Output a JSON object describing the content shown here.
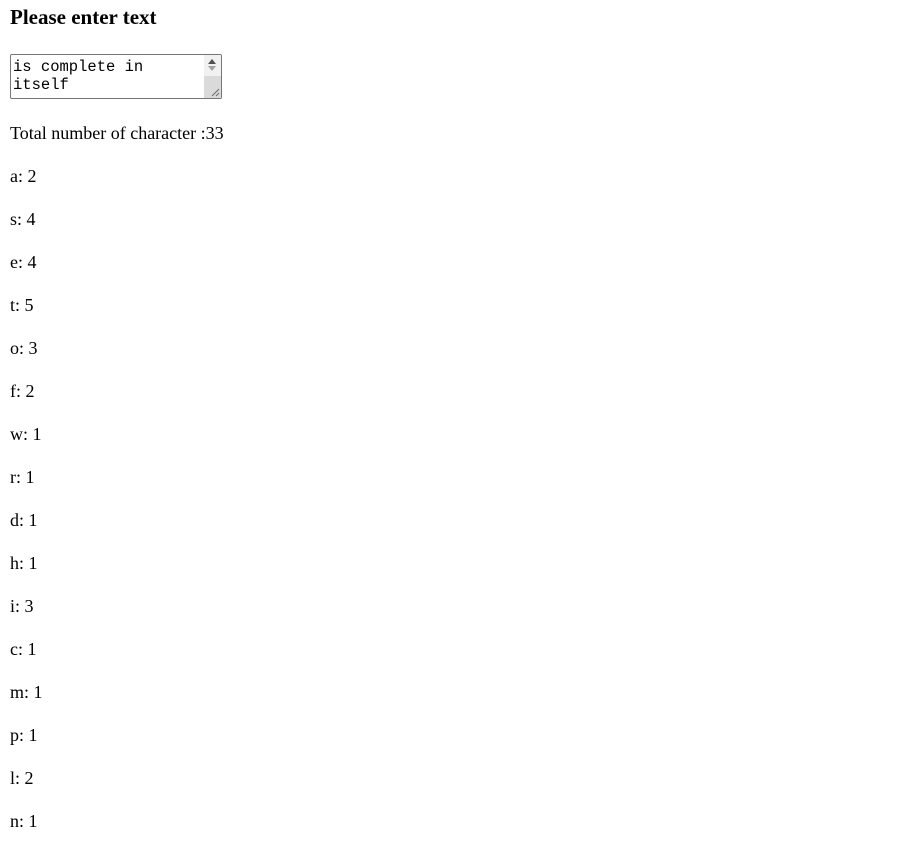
{
  "heading": "Please enter text",
  "textarea": {
    "value": "is complete in\nitself"
  },
  "total": {
    "label": "Total number of character :",
    "value": "33",
    "text": "Total number of character :33"
  },
  "counts": [
    {
      "char": "a",
      "count": 2,
      "text": "a: 2"
    },
    {
      "char": "s",
      "count": 4,
      "text": "s: 4"
    },
    {
      "char": "e",
      "count": 4,
      "text": "e: 4"
    },
    {
      "char": "t",
      "count": 5,
      "text": "t: 5"
    },
    {
      "char": "o",
      "count": 3,
      "text": "o: 3"
    },
    {
      "char": "f",
      "count": 2,
      "text": "f: 2"
    },
    {
      "char": "w",
      "count": 1,
      "text": "w: 1"
    },
    {
      "char": "r",
      "count": 1,
      "text": "r: 1"
    },
    {
      "char": "d",
      "count": 1,
      "text": "d: 1"
    },
    {
      "char": "h",
      "count": 1,
      "text": "h: 1"
    },
    {
      "char": "i",
      "count": 3,
      "text": "i: 3"
    },
    {
      "char": "c",
      "count": 1,
      "text": "c: 1"
    },
    {
      "char": "m",
      "count": 1,
      "text": "m: 1"
    },
    {
      "char": "p",
      "count": 1,
      "text": "p: 1"
    },
    {
      "char": "l",
      "count": 2,
      "text": "l: 2"
    },
    {
      "char": "n",
      "count": 1,
      "text": "n: 1"
    }
  ]
}
